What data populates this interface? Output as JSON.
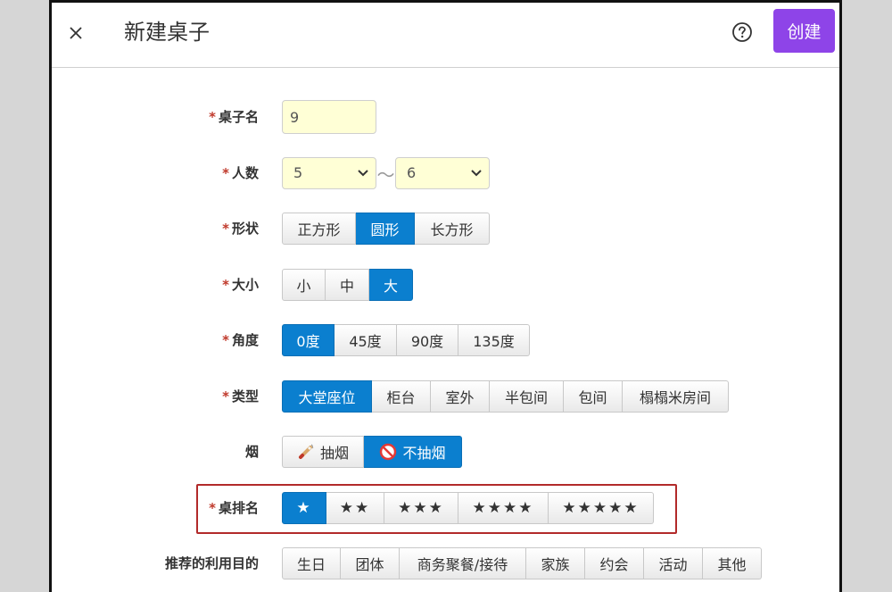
{
  "header": {
    "title": "新建桌子",
    "create_label": "创建"
  },
  "icons": {
    "close": "close-icon",
    "help": "help-circle-icon",
    "smoking": "cigarette-icon",
    "no_smoking": "no-smoking-icon"
  },
  "colors": {
    "accent_blue": "#0b7fcf",
    "create_purple": "#8e44e8",
    "required_red": "#c0392b",
    "input_bg": "#ffffd6",
    "highlight_border": "#b22a2a"
  },
  "form": {
    "table_name": {
      "label": "桌子名",
      "required": true,
      "value": "9"
    },
    "people": {
      "label": "人数",
      "required": true,
      "min": "5",
      "separator": "～",
      "max": "6"
    },
    "shape": {
      "label": "形状",
      "required": true,
      "options": [
        "正方形",
        "圆形",
        "长方形"
      ],
      "selected": 1
    },
    "size": {
      "label": "大小",
      "required": true,
      "options": [
        "小",
        "中",
        "大"
      ],
      "selected": 2
    },
    "angle": {
      "label": "角度",
      "required": true,
      "options": [
        "0度",
        "45度",
        "90度",
        "135度"
      ],
      "selected": 0
    },
    "type": {
      "label": "类型",
      "required": true,
      "options": [
        "大堂座位",
        "柜台",
        "室外",
        "半包间",
        "包间",
        "榻榻米房间"
      ],
      "selected": 0
    },
    "smoke": {
      "label": "烟",
      "required": false,
      "options": [
        "抽烟",
        "不抽烟"
      ],
      "selected": 1
    },
    "rank": {
      "label": "桌排名",
      "required": true,
      "options": [
        "★",
        "★★",
        "★★★",
        "★★★★",
        "★★★★★"
      ],
      "selected": 0
    },
    "purpose": {
      "label": "推荐的利用目的",
      "required": false,
      "options": [
        "生日",
        "团体",
        "商务聚餐/接待",
        "家族",
        "约会",
        "活动",
        "其他"
      ],
      "selected": -1
    }
  }
}
